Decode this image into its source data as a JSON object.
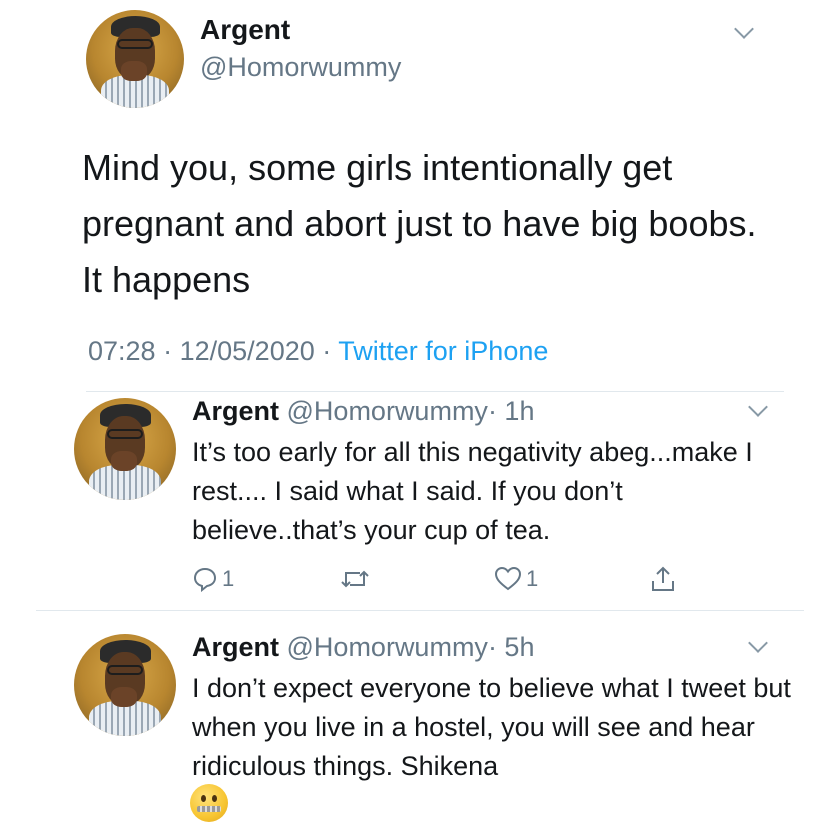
{
  "main_tweet": {
    "name": "Argent",
    "handle": "@Homorwummy",
    "text": "Mind you, some girls intentionally get pregnant and abort just to have big boobs. It happens",
    "time": "07:28",
    "date": "12/05/2020",
    "separator": "·",
    "source": "Twitter for iPhone"
  },
  "replies": [
    {
      "name": "Argent",
      "handle": "@Homorwummy",
      "age": "· 1h",
      "text": "It’s too early for all this negativity abeg...make I rest.... I said what I said. If you don’t believe..that’s your cup of tea.",
      "reply_count": "1",
      "like_count": "1"
    },
    {
      "name": "Argent",
      "handle": "@Homorwummy",
      "age": "· 5h",
      "text": "I don’t expect everyone to believe what I tweet but when you live in a hostel, you will see and hear ridiculous things. Shikena",
      "emoji": "zipper-mouth-face"
    }
  ],
  "colors": {
    "text": "#14171a",
    "secondary": "#657786",
    "link": "#1da1f2",
    "divider": "#e1e8ed"
  }
}
